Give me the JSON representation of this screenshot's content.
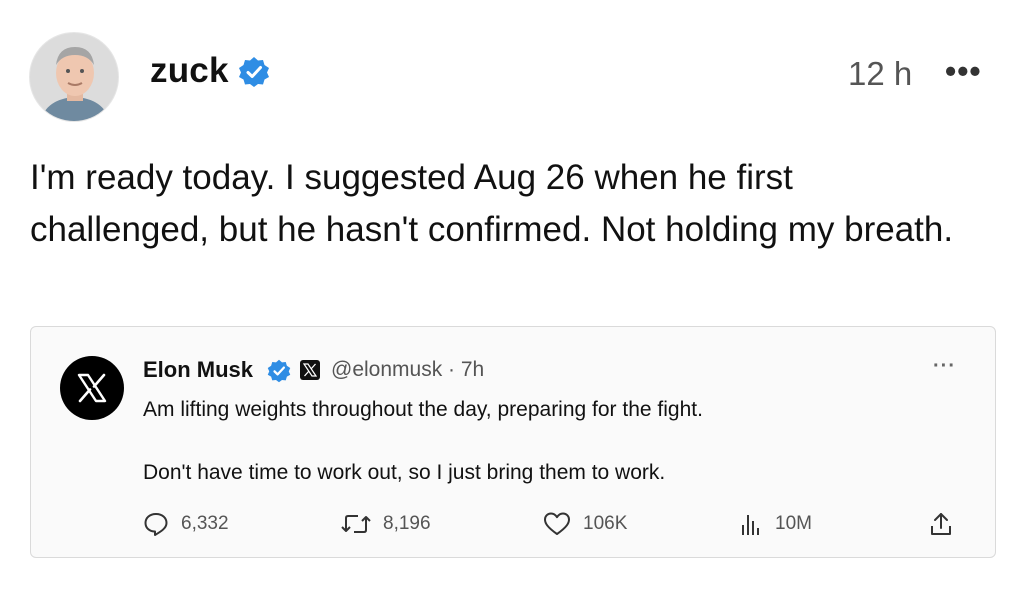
{
  "post": {
    "username": "zuck",
    "time": "12 h",
    "more": "•••",
    "text": "I'm ready today. I suggested Aug 26 when he first challenged, but he hasn't confirmed. Not holding my breath."
  },
  "quoted": {
    "name": "Elon Musk",
    "handle": "@elonmusk · 7h",
    "more": "···",
    "text_line1": "Am lifting weights throughout the day, preparing for the fight.",
    "text_line2": "Don't have time to work out, so I just bring them to work.",
    "stats": {
      "replies": "6,332",
      "reposts": "8,196",
      "likes": "106K",
      "views": "10M"
    }
  },
  "colors": {
    "verified": "#2f8de4",
    "text": "#111111",
    "muted": "#555555",
    "card_border": "#dadada"
  },
  "icons": [
    "verified-badge-icon",
    "x-logo-icon",
    "more-icon",
    "reply-icon",
    "repost-icon",
    "like-icon",
    "views-icon",
    "share-icon"
  ]
}
